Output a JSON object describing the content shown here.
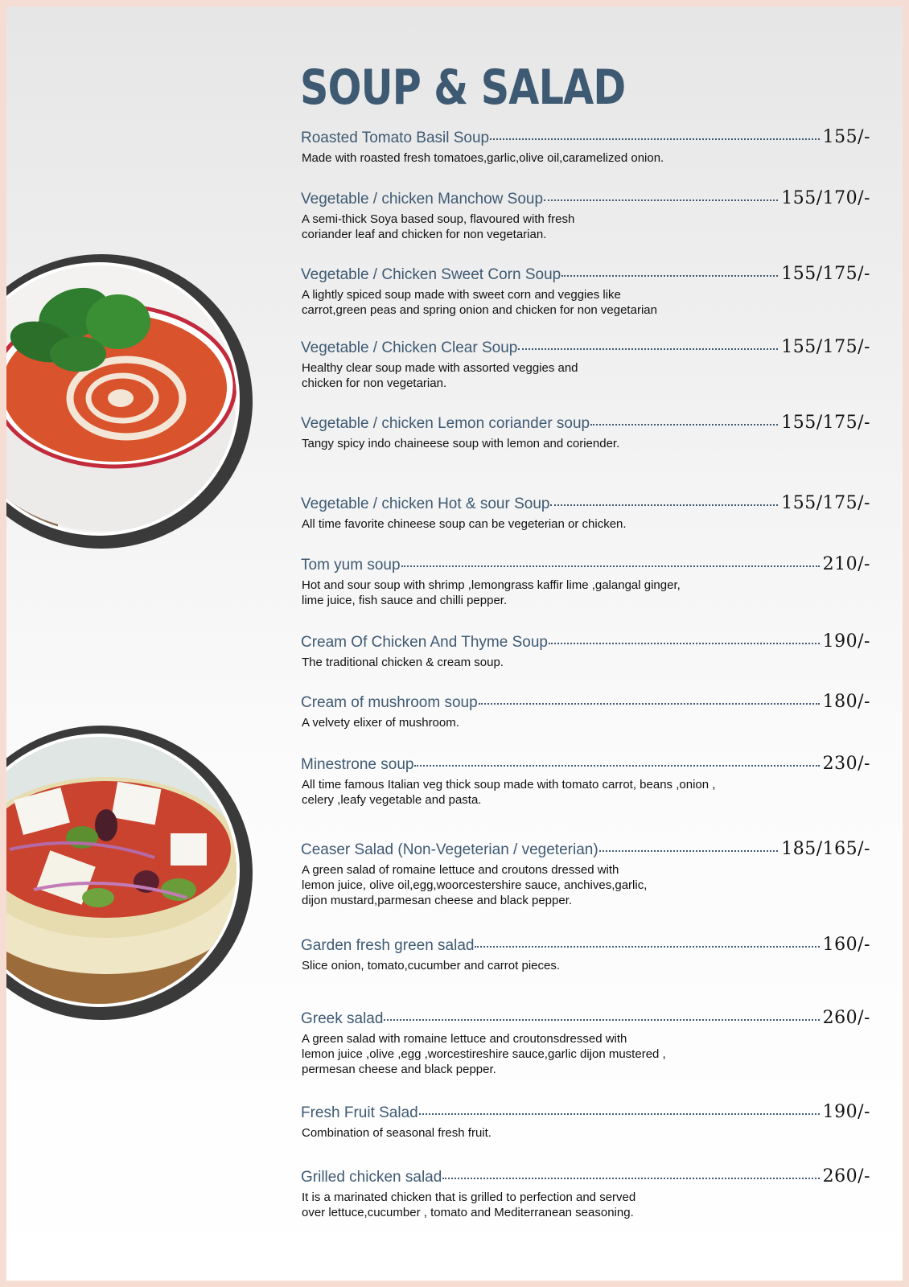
{
  "title": "SOUP & SALAD",
  "items": [
    {
      "name": "Roasted Tomato Basil Soup",
      "price": "155/-",
      "desc": "Made with roasted fresh tomatoes,garlic,olive oil,caramelized onion."
    },
    {
      "name": "Vegetable / chicken Manchow Soup",
      "price": "155/170/-",
      "desc": "A semi-thick Soya based soup, flavoured with fresh\ncoriander leaf and chicken for non vegetarian."
    },
    {
      "name": "Vegetable / Chicken Sweet Corn Soup",
      "price": "155/175/-",
      "desc": "A lightly spiced soup made with sweet corn and veggies like\ncarrot,green peas and spring onion and chicken for non vegetarian"
    },
    {
      "name": "Vegetable / Chicken Clear Soup",
      "price": "155/175/-",
      "desc": "Healthy clear soup made with assorted veggies and\nchicken for non vegetarian."
    },
    {
      "name": "Vegetable / chicken Lemon coriander soup",
      "price": "155/175/-",
      "desc": "Tangy spicy indo chaineese soup with lemon and coriender."
    },
    {
      "name": "Vegetable / chicken Hot & sour Soup",
      "price": "155/175/-",
      "desc": "All time favorite chineese soup can be vegeterian or chicken."
    },
    {
      "name": "Tom yum soup",
      "price": "210/-",
      "desc": "Hot and sour soup with shrimp ,lemongrass kaffir lime ,galangal ginger,\nlime juice, fish sauce and chilli pepper."
    },
    {
      "name": "Cream Of Chicken And Thyme Soup",
      "price": "190/-",
      "desc": "The traditional chicken & cream soup."
    },
    {
      "name": "Cream of mushroom soup",
      "price": "180/-",
      "desc": "A velvety elixer of mushroom."
    },
    {
      "name": "Minestrone soup",
      "price": "230/-",
      "desc": "All time famous Italian veg thick soup made with tomato carrot, beans ,onion ,\ncelery ,leafy vegetable and pasta."
    },
    {
      "name": "Ceaser Salad (Non-Vegeterian / vegeterian)",
      "price": "185/165/-",
      "desc": "A green salad of romaine lettuce and croutons dressed with\nlemon juice, olive oil,egg,woorcestershire sauce, anchives,garlic,\ndijon mustard,parmesan cheese and black pepper."
    },
    {
      "name": "Garden fresh green salad",
      "price": "160/-",
      "desc": "Slice onion, tomato,cucumber and carrot pieces."
    },
    {
      "name": "Greek salad",
      "price": "260/-",
      "desc": "A green salad with romaine lettuce and croutonsdressed with\nlemon juice ,olive ,egg ,worcestireshire sauce,garlic dijon mustered ,\npermesan cheese and black pepper."
    },
    {
      "name": "Fresh Fruit Salad",
      "price": "190/-",
      "desc": "Combination of seasonal fresh fruit."
    },
    {
      "name": "Grilled chicken salad",
      "price": "260/-",
      "desc": "It is a marinated chicken that is grilled to perfection and served\nover lettuce,cucumber , tomato and Mediterranean seasoning."
    }
  ],
  "colors": {
    "heading": "#3e5a73",
    "border": "#f6ddd4",
    "ring": "#3a3a3a"
  }
}
